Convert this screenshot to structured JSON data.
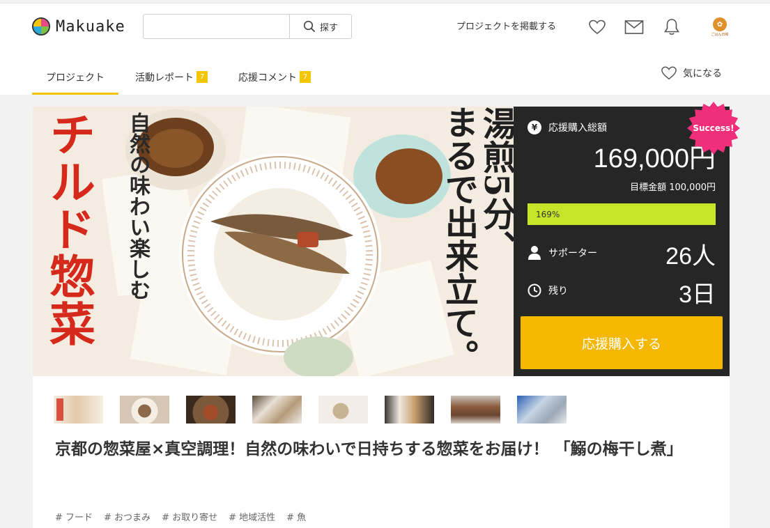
{
  "brand": {
    "name": "Makuake"
  },
  "search": {
    "placeholder": "",
    "button_label": "探す"
  },
  "header": {
    "post_project_label": "プロジェクトを掲載する",
    "avatar_caption": "ごはん日和"
  },
  "tabs": [
    {
      "label": "プロジェクト",
      "badge": ""
    },
    {
      "label": "活動レポート",
      "badge": "7"
    },
    {
      "label": "応援コメント",
      "badge": "7"
    }
  ],
  "watch_label": "気になる",
  "hero": {
    "left_main": "チルド惣菜",
    "left_sub": "自然の味わい楽しむ",
    "right_col1": "湯煎5分、",
    "right_col2": "まるで出来立て。"
  },
  "funding": {
    "badge": "Success!",
    "total_label": "応援購入総額",
    "total_amount": "169,000円",
    "goal_text": "目標金額 100,000円",
    "progress_percent": 169,
    "progress_label": "169%",
    "supporters_label": "サポーター",
    "supporters_value": "26人",
    "remaining_label": "残り",
    "remaining_value": "3日",
    "cta_label": "応援購入する"
  },
  "project": {
    "title": "京都の惣菜屋×真空調理！自然の味わいで日持ちする惣菜をお届け！ 「鰯の梅干し煮」",
    "tags": [
      "# フード",
      "# おつまみ",
      "# お取り寄せ",
      "# 地域活性",
      "# 魚"
    ]
  },
  "colors": {
    "accent": "#f5c500",
    "cta": "#f5b700",
    "panel": "#262626",
    "progress": "#c6e529",
    "success": "#ef2f7a",
    "hero_red": "#d5291c"
  }
}
